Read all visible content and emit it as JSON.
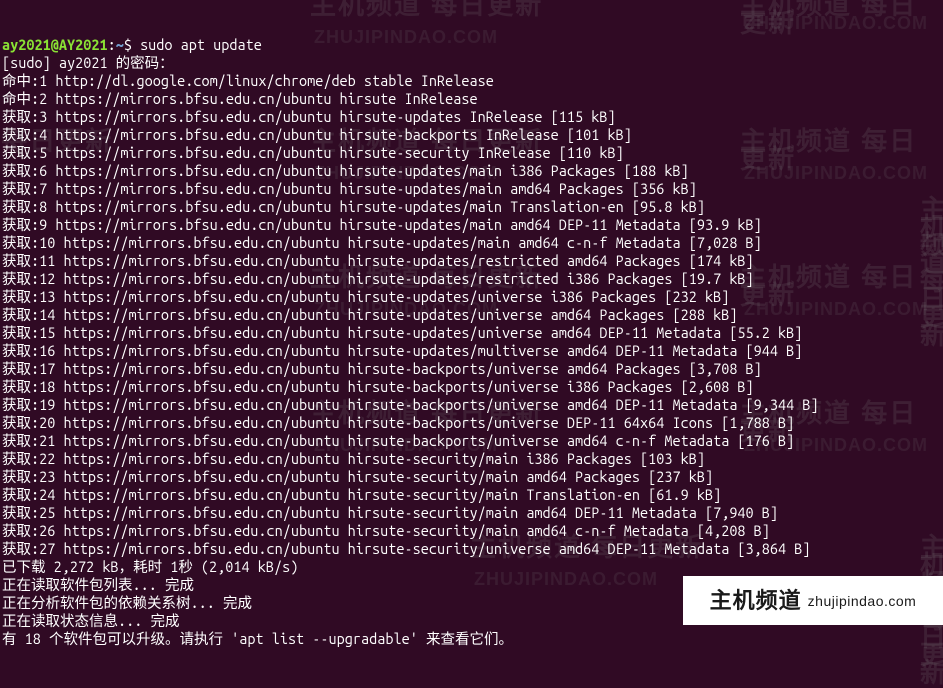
{
  "prompt": {
    "user": "ay2021@AY2021",
    "sep1": ":",
    "path": "~",
    "sep2": "$ ",
    "command": "sudo apt update"
  },
  "lines": [
    "[sudo] ay2021 的密码：",
    "命中:1 http://dl.google.com/linux/chrome/deb stable InRelease",
    "命中:2 https://mirrors.bfsu.edu.cn/ubuntu hirsute InRelease",
    "获取:3 https://mirrors.bfsu.edu.cn/ubuntu hirsute-updates InRelease [115 kB]",
    "获取:4 https://mirrors.bfsu.edu.cn/ubuntu hirsute-backports InRelease [101 kB]",
    "获取:5 https://mirrors.bfsu.edu.cn/ubuntu hirsute-security InRelease [110 kB]",
    "获取:6 https://mirrors.bfsu.edu.cn/ubuntu hirsute-updates/main i386 Packages [188 kB]",
    "获取:7 https://mirrors.bfsu.edu.cn/ubuntu hirsute-updates/main amd64 Packages [356 kB]",
    "获取:8 https://mirrors.bfsu.edu.cn/ubuntu hirsute-updates/main Translation-en [95.8 kB]",
    "获取:9 https://mirrors.bfsu.edu.cn/ubuntu hirsute-updates/main amd64 DEP-11 Metadata [93.9 kB]",
    "获取:10 https://mirrors.bfsu.edu.cn/ubuntu hirsute-updates/main amd64 c-n-f Metadata [7,028 B]",
    "获取:11 https://mirrors.bfsu.edu.cn/ubuntu hirsute-updates/restricted amd64 Packages [174 kB]",
    "获取:12 https://mirrors.bfsu.edu.cn/ubuntu hirsute-updates/restricted i386 Packages [19.7 kB]",
    "获取:13 https://mirrors.bfsu.edu.cn/ubuntu hirsute-updates/universe i386 Packages [232 kB]",
    "获取:14 https://mirrors.bfsu.edu.cn/ubuntu hirsute-updates/universe amd64 Packages [288 kB]",
    "获取:15 https://mirrors.bfsu.edu.cn/ubuntu hirsute-updates/universe amd64 DEP-11 Metadata [55.2 kB]",
    "获取:16 https://mirrors.bfsu.edu.cn/ubuntu hirsute-updates/multiverse amd64 DEP-11 Metadata [944 B]",
    "获取:17 https://mirrors.bfsu.edu.cn/ubuntu hirsute-backports/universe amd64 Packages [3,708 B]",
    "获取:18 https://mirrors.bfsu.edu.cn/ubuntu hirsute-backports/universe i386 Packages [2,608 B]",
    "获取:19 https://mirrors.bfsu.edu.cn/ubuntu hirsute-backports/universe amd64 DEP-11 Metadata [9,344 B]",
    "获取:20 https://mirrors.bfsu.edu.cn/ubuntu hirsute-backports/universe DEP-11 64x64 Icons [1,788 B]",
    "获取:21 https://mirrors.bfsu.edu.cn/ubuntu hirsute-backports/universe amd64 c-n-f Metadata [176 B]",
    "获取:22 https://mirrors.bfsu.edu.cn/ubuntu hirsute-security/main i386 Packages [103 kB]",
    "获取:23 https://mirrors.bfsu.edu.cn/ubuntu hirsute-security/main amd64 Packages [237 kB]",
    "获取:24 https://mirrors.bfsu.edu.cn/ubuntu hirsute-security/main Translation-en [61.9 kB]",
    "获取:25 https://mirrors.bfsu.edu.cn/ubuntu hirsute-security/main amd64 DEP-11 Metadata [7,940 B]",
    "获取:26 https://mirrors.bfsu.edu.cn/ubuntu hirsute-security/main amd64 c-n-f Metadata [4,208 B]",
    "获取:27 https://mirrors.bfsu.edu.cn/ubuntu hirsute-security/universe amd64 DEP-11 Metadata [3,864 B]",
    "已下载 2,272 kB，耗时 1秒 (2,014 kB/s)",
    "正在读取软件包列表... 完成",
    "正在分析软件包的依赖关系树... 完成",
    "正在读取状态信息... 完成",
    "有 18 个软件包可以升级。请执行 'apt list --upgradable' 来查看它们。"
  ],
  "watermark": {
    "cn": "主机频道 每日更新",
    "en": "ZHUJIPINDAO.COM"
  },
  "badge": {
    "cn": "主机频道",
    "en": "zhujipindao.com"
  }
}
